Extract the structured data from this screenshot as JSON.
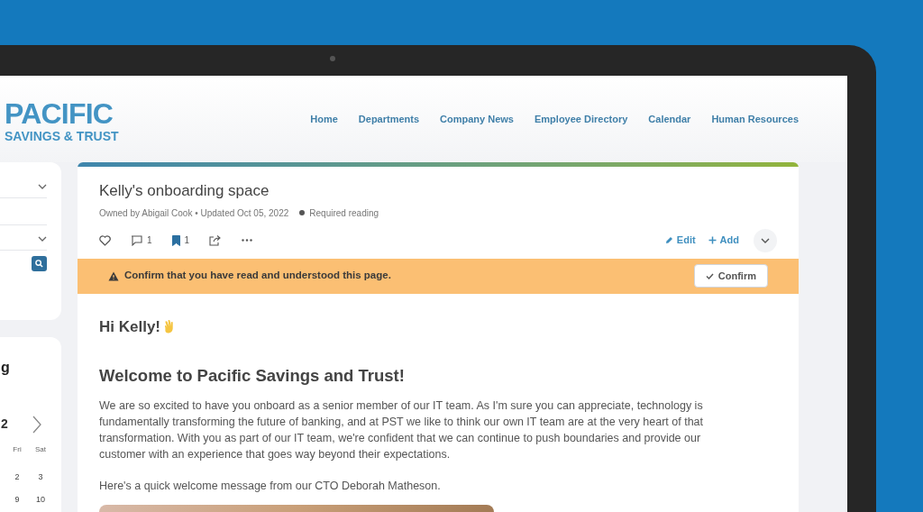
{
  "logo": {
    "line_1": "PACIFIC",
    "line_2": "SAVINGS & TRUST"
  },
  "nav": [
    {
      "label": "Home"
    },
    {
      "label": "Departments"
    },
    {
      "label": "Company News"
    },
    {
      "label": "Employee Directory"
    },
    {
      "label": "Calendar"
    },
    {
      "label": "Human Resources"
    }
  ],
  "calendar": {
    "title": "g",
    "month": "2",
    "weekdays": [
      "Fri",
      "Sat"
    ],
    "weeks": [
      [
        "2",
        "3"
      ],
      [
        "9",
        "10"
      ]
    ]
  },
  "page": {
    "title": "Kelly's onboarding space",
    "meta": "Owned by Abigail Cook • Updated Oct 05, 2022",
    "status": "Required reading",
    "comments": "1",
    "bookmarks": "1",
    "bookmarked": true,
    "actions": [
      {
        "kind": "edit",
        "label": "Edit"
      },
      {
        "kind": "add",
        "label": "Add"
      }
    ]
  },
  "banner": {
    "message": "Confirm that you have read and understood this page.",
    "button": "Confirm"
  },
  "content": {
    "greeting": "Hi Kelly!",
    "heading": "Welcome to Pacific Savings and Trust!",
    "paragraphs": [
      "We are so excited to have you onboard as a senior member of our IT team. As I'm sure you can appreciate, technology is fundamentally transforming the future of banking, and at PST we like to think our own IT team are at the very heart of that transformation. With you as part of our IT team, we're confident that we can continue to push boundaries and provide our customer with an experience that goes way beyond their expectations.",
      "Here's a quick welcome message from our CTO Deborah Matheson."
    ]
  }
}
